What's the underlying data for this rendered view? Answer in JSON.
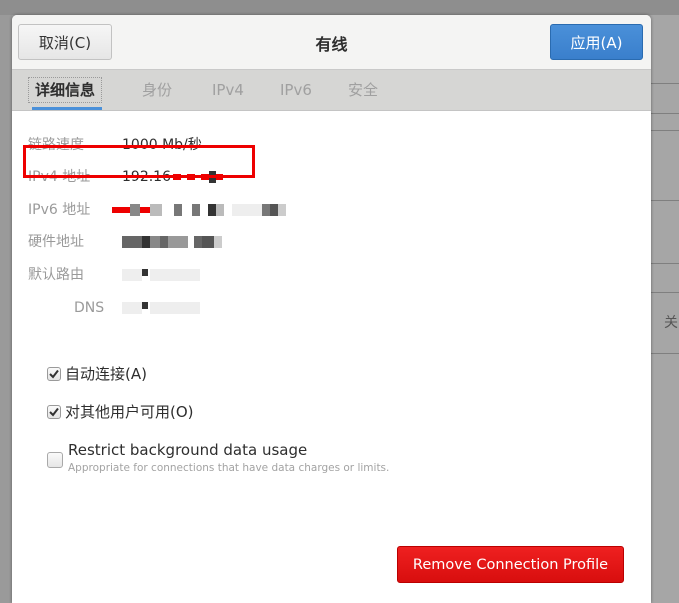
{
  "dialog": {
    "title": "有线",
    "cancel_label": "取消(C)",
    "apply_label": "应用(A)",
    "colors": {
      "apply": "#3a7fcc",
      "remove": "#e01414",
      "highlight": "#ee0000"
    }
  },
  "tabs": [
    {
      "label": "详细信息",
      "active": true
    },
    {
      "label": "身份",
      "active": false
    },
    {
      "label": "IPv4",
      "active": false
    },
    {
      "label": "IPv6",
      "active": false
    },
    {
      "label": "安全",
      "active": false
    }
  ],
  "details": {
    "link_speed": {
      "label": "链路速度",
      "value": "1000 Mb/秒"
    },
    "ipv4": {
      "label": "IPv4 地址",
      "value": "192.16"
    },
    "ipv6": {
      "label": "IPv6 地址",
      "value": ""
    },
    "hardware": {
      "label": "硬件地址",
      "value": ""
    },
    "default_route": {
      "label": "默认路由",
      "value": ""
    },
    "dns": {
      "label": "DNS",
      "value": ""
    }
  },
  "options": {
    "auto_connect": {
      "label": "自动连接(A)",
      "checked": true
    },
    "available_all_users": {
      "label": "对其他用户可用(O)",
      "checked": true
    },
    "restrict_background": {
      "label": "Restrict background data usage",
      "description": "Appropriate for connections that have data charges or limits.",
      "checked": false
    }
  },
  "remove_label": "Remove Connection Profile",
  "background": {
    "partial_text": "关"
  }
}
